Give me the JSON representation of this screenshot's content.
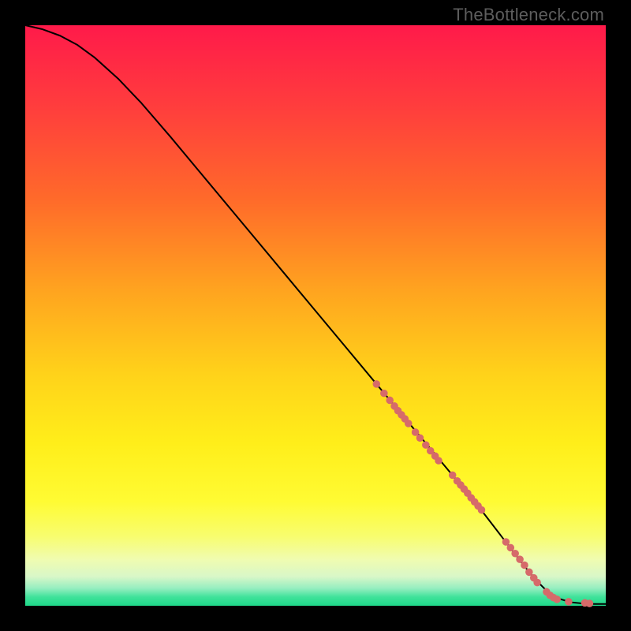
{
  "watermark": "TheBottleneck.com",
  "gradient_stops": [
    {
      "pct": 0,
      "color": "#ff1a4a"
    },
    {
      "pct": 14,
      "color": "#ff3d3d"
    },
    {
      "pct": 30,
      "color": "#ff6a2a"
    },
    {
      "pct": 46,
      "color": "#ffa51f"
    },
    {
      "pct": 60,
      "color": "#ffd21a"
    },
    {
      "pct": 72,
      "color": "#ffee1a"
    },
    {
      "pct": 82,
      "color": "#fffb33"
    },
    {
      "pct": 88,
      "color": "#f8fd6e"
    },
    {
      "pct": 92,
      "color": "#f0fcb0"
    },
    {
      "pct": 95,
      "color": "#d8f7c8"
    },
    {
      "pct": 97,
      "color": "#95eec0"
    },
    {
      "pct": 98.5,
      "color": "#3fe29a"
    },
    {
      "pct": 100,
      "color": "#1fd98a"
    }
  ],
  "chart_data": {
    "type": "line",
    "title": "",
    "xlabel": "",
    "ylabel": "",
    "xlim": [
      0,
      100
    ],
    "ylim": [
      0,
      100
    ],
    "series": [
      {
        "name": "curve",
        "x": [
          0,
          3,
          6,
          9,
          12,
          16,
          20,
          25,
          30,
          35,
          40,
          45,
          50,
          55,
          60,
          65,
          70,
          75,
          78,
          80,
          82,
          84,
          86,
          88,
          90,
          92,
          94,
          96,
          98,
          100
        ],
        "y": [
          100,
          99.3,
          98.2,
          96.6,
          94.4,
          90.8,
          86.6,
          80.8,
          74.8,
          68.8,
          62.8,
          56.8,
          50.8,
          44.8,
          38.8,
          32.8,
          26.8,
          20.8,
          17.2,
          14.6,
          12.0,
          9.4,
          6.8,
          4.4,
          2.4,
          1.2,
          0.6,
          0.4,
          0.3,
          0.3
        ]
      }
    ],
    "scatter": {
      "name": "points",
      "color": "#d66a6a",
      "radius_pct": 0.65,
      "x": [
        60.5,
        61.8,
        62.8,
        63.6,
        64.2,
        64.8,
        65.4,
        66.0,
        67.2,
        68.0,
        69.0,
        69.8,
        70.6,
        71.2,
        73.6,
        74.4,
        75.0,
        75.6,
        76.2,
        76.8,
        77.4,
        78.0,
        78.6,
        82.8,
        83.6,
        84.4,
        85.2,
        86.0,
        86.8,
        87.6,
        88.2,
        89.8,
        90.4,
        91.0,
        91.6,
        93.6,
        96.4,
        97.2
      ],
      "y": [
        38.2,
        36.6,
        35.4,
        34.4,
        33.6,
        32.9,
        32.2,
        31.4,
        29.9,
        28.9,
        27.7,
        26.7,
        25.8,
        25.0,
        22.5,
        21.5,
        20.8,
        20.1,
        19.4,
        18.6,
        17.9,
        17.2,
        16.5,
        11.0,
        10.0,
        9.0,
        8.0,
        7.0,
        5.8,
        4.8,
        4.0,
        2.4,
        1.8,
        1.4,
        1.1,
        0.7,
        0.5,
        0.4
      ]
    }
  }
}
